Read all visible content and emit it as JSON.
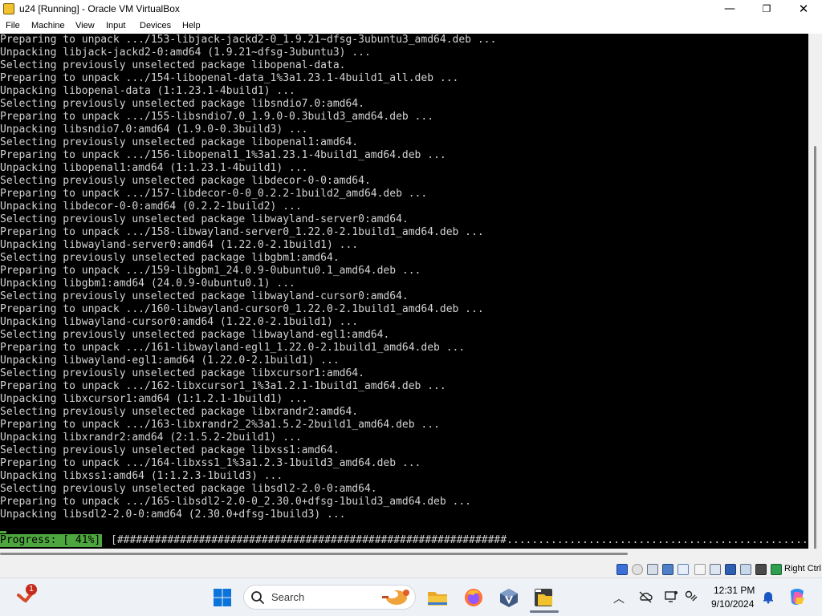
{
  "window": {
    "title": "u24 [Running] - Oracle VM VirtualBox",
    "minimize_glyph": "—",
    "maximize_glyph": "❐",
    "close_glyph": "✕"
  },
  "menu": {
    "file": "File",
    "machine": "Machine",
    "view": "View",
    "input": "Input",
    "devices": "Devices",
    "help": "Help"
  },
  "console": {
    "lines": [
      "Preparing to unpack .../153-libjack-jackd2-0_1.9.21~dfsg-3ubuntu3_amd64.deb ...",
      "Unpacking libjack-jackd2-0:amd64 (1.9.21~dfsg-3ubuntu3) ...",
      "Selecting previously unselected package libopenal-data.",
      "Preparing to unpack .../154-libopenal-data_1%3a1.23.1-4build1_all.deb ...",
      "Unpacking libopenal-data (1:1.23.1-4build1) ...",
      "Selecting previously unselected package libsndio7.0:amd64.",
      "Preparing to unpack .../155-libsndio7.0_1.9.0-0.3build3_amd64.deb ...",
      "Unpacking libsndio7.0:amd64 (1.9.0-0.3build3) ...",
      "Selecting previously unselected package libopenal1:amd64.",
      "Preparing to unpack .../156-libopenal1_1%3a1.23.1-4build1_amd64.deb ...",
      "Unpacking libopenal1:amd64 (1:1.23.1-4build1) ...",
      "Selecting previously unselected package libdecor-0-0:amd64.",
      "Preparing to unpack .../157-libdecor-0-0_0.2.2-1build2_amd64.deb ...",
      "Unpacking libdecor-0-0:amd64 (0.2.2-1build2) ...",
      "Selecting previously unselected package libwayland-server0:amd64.",
      "Preparing to unpack .../158-libwayland-server0_1.22.0-2.1build1_amd64.deb ...",
      "Unpacking libwayland-server0:amd64 (1.22.0-2.1build1) ...",
      "Selecting previously unselected package libgbm1:amd64.",
      "Preparing to unpack .../159-libgbm1_24.0.9-0ubuntu0.1_amd64.deb ...",
      "Unpacking libgbm1:amd64 (24.0.9-0ubuntu0.1) ...",
      "Selecting previously unselected package libwayland-cursor0:amd64.",
      "Preparing to unpack .../160-libwayland-cursor0_1.22.0-2.1build1_amd64.deb ...",
      "Unpacking libwayland-cursor0:amd64 (1.22.0-2.1build1) ...",
      "Selecting previously unselected package libwayland-egl1:amd64.",
      "Preparing to unpack .../161-libwayland-egl1_1.22.0-2.1build1_amd64.deb ...",
      "Unpacking libwayland-egl1:amd64 (1.22.0-2.1build1) ...",
      "Selecting previously unselected package libxcursor1:amd64.",
      "Preparing to unpack .../162-libxcursor1_1%3a1.2.1-1build1_amd64.deb ...",
      "Unpacking libxcursor1:amd64 (1:1.2.1-1build1) ...",
      "Selecting previously unselected package libxrandr2:amd64.",
      "Preparing to unpack .../163-libxrandr2_2%3a1.5.2-2build1_amd64.deb ...",
      "Unpacking libxrandr2:amd64 (2:1.5.2-2build1) ...",
      "Selecting previously unselected package libxss1:amd64.",
      "Preparing to unpack .../164-libxss1_1%3a1.2.3-1build3_amd64.deb ...",
      "Unpacking libxss1:amd64 (1:1.2.3-1build3) ...",
      "Selecting previously unselected package libsdl2-2.0-0:amd64.",
      "Preparing to unpack .../165-libsdl2-2.0-0_2.30.0+dfsg-1build3_amd64.deb ...",
      "Unpacking libsdl2-2.0-0:amd64 (2.30.0+dfsg-1build3) ..."
    ],
    "progress_label": "Progress: [ 41%]",
    "progress_bar": "[##############################################################..........................................................",
    "progress_percent": 41
  },
  "statusbar": {
    "host_key": "Right Ctrl"
  },
  "taskbar": {
    "widgets_badge": "1",
    "search_placeholder": "Search",
    "clock_time": "12:31 PM",
    "clock_date": "9/10/2024"
  },
  "colors": {
    "console_bg": "#000000",
    "console_text": "#d3d3d3",
    "progress_green": "#4ea63e",
    "taskbar_bg": "#eef1f5"
  }
}
